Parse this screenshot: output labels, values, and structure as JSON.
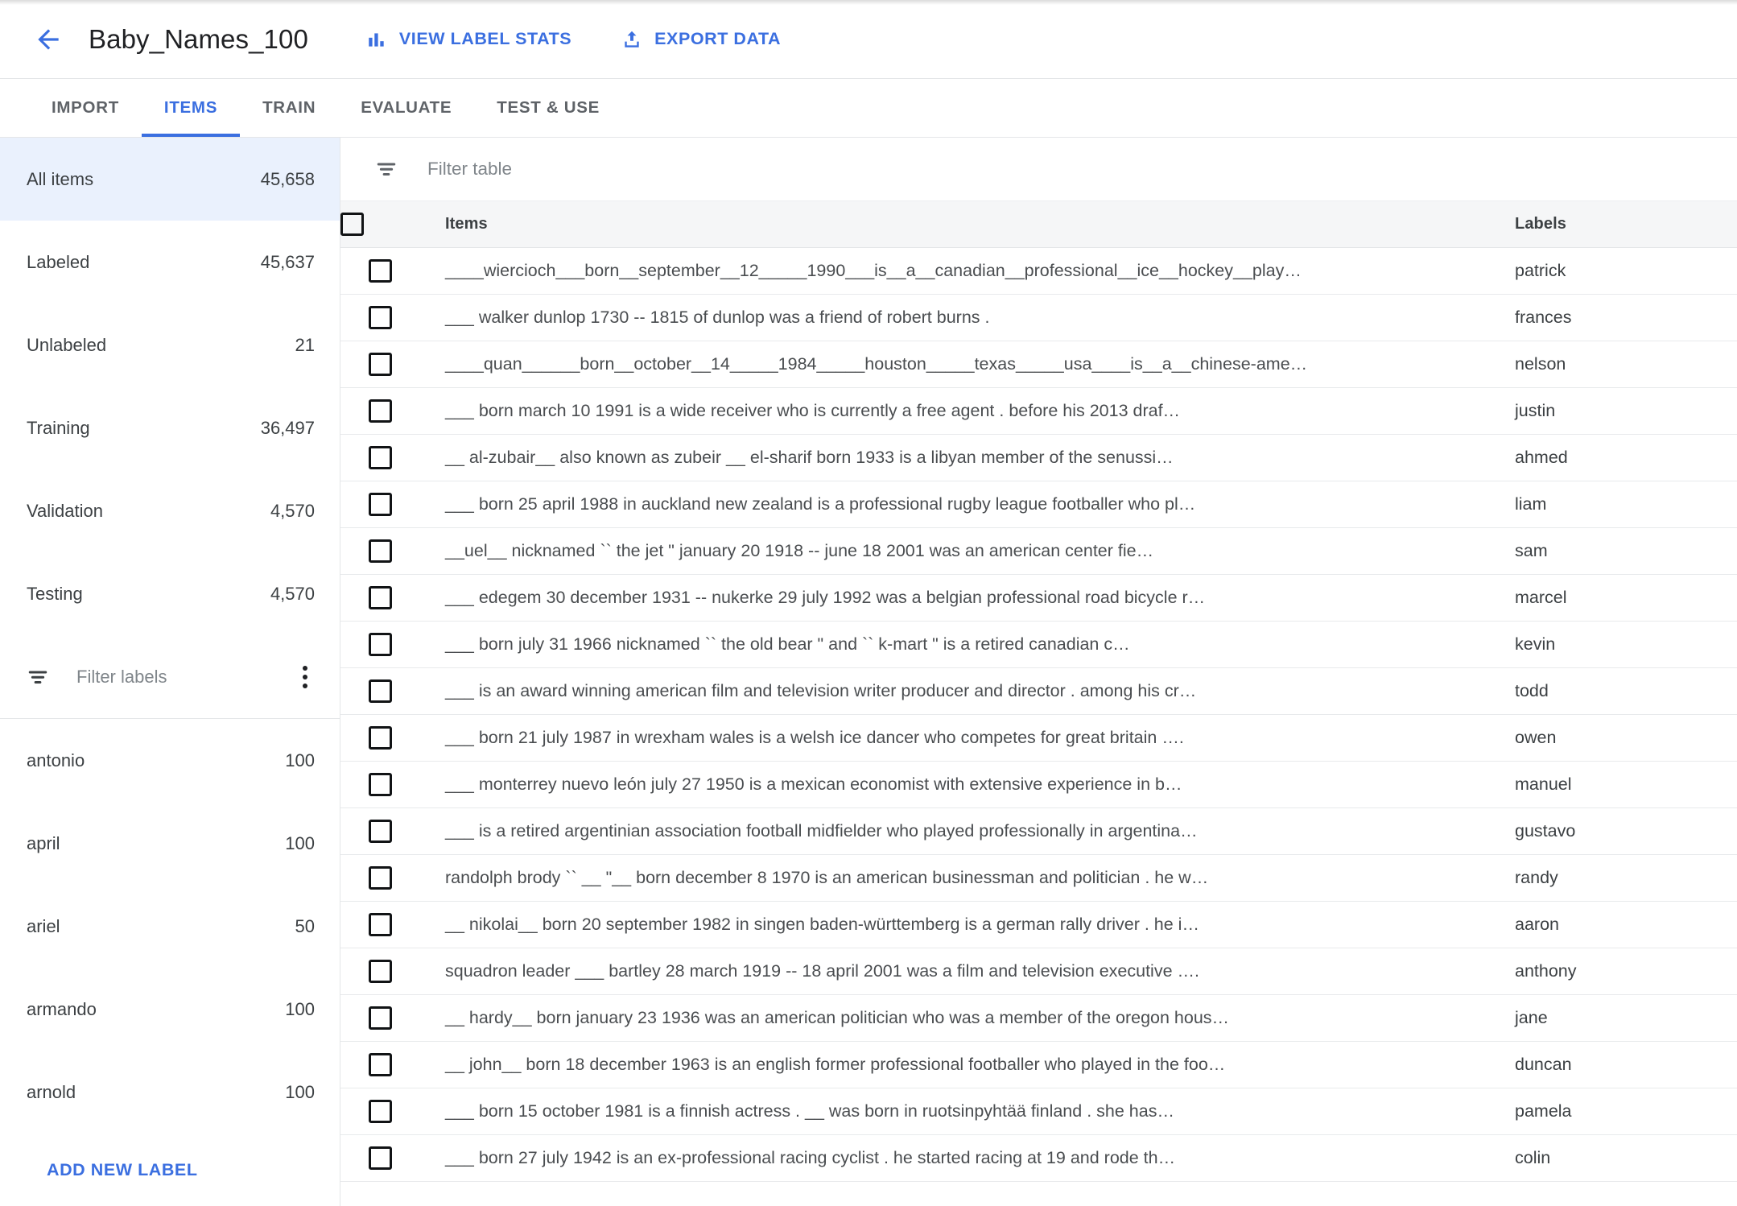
{
  "header": {
    "back_icon": "arrow-back-icon",
    "title": "Baby_Names_100",
    "actions": [
      {
        "icon": "bar-chart-icon",
        "label": "VIEW LABEL STATS"
      },
      {
        "icon": "upload-export-icon",
        "label": "EXPORT DATA"
      }
    ]
  },
  "tabs": [
    {
      "label": "IMPORT",
      "active": false
    },
    {
      "label": "ITEMS",
      "active": true
    },
    {
      "label": "TRAIN",
      "active": false
    },
    {
      "label": "EVALUATE",
      "active": false
    },
    {
      "label": "TEST & USE",
      "active": false
    }
  ],
  "sidebar": {
    "stats": [
      {
        "label": "All items",
        "count": "45,658",
        "selected": true
      },
      {
        "label": "Labeled",
        "count": "45,637",
        "selected": false
      },
      {
        "label": "Unlabeled",
        "count": "21",
        "selected": false
      },
      {
        "label": "Training",
        "count": "36,497",
        "selected": false
      },
      {
        "label": "Validation",
        "count": "4,570",
        "selected": false
      },
      {
        "label": "Testing",
        "count": "4,570",
        "selected": false
      }
    ],
    "filter_labels": {
      "icon": "filter-icon",
      "placeholder": "Filter labels",
      "menu_icon": "more-vert-icon"
    },
    "labels": [
      {
        "name": "antonio",
        "count": "100"
      },
      {
        "name": "april",
        "count": "100"
      },
      {
        "name": "ariel",
        "count": "50"
      },
      {
        "name": "armando",
        "count": "100"
      },
      {
        "name": "arnold",
        "count": "100"
      }
    ],
    "add_new_label": "ADD NEW LABEL"
  },
  "table": {
    "filter": {
      "icon": "filter-icon",
      "placeholder": "Filter table"
    },
    "columns": [
      "",
      "Items",
      "Labels"
    ],
    "header_checkbox": "select-all-checkbox",
    "rows": [
      {
        "item": "____wiercioch___born__september__12_____1990___is__a__canadian__professional__ice__hockey__play…",
        "label": "patrick"
      },
      {
        "item": "___ walker dunlop 1730 -- 1815 of dunlop was a friend of robert burns .",
        "label": "frances"
      },
      {
        "item": "____quan______born__october__14_____1984_____houston_____texas_____usa____is__a__chinese-ame…",
        "label": "nelson"
      },
      {
        "item": "___ born march 10 1991 is a wide receiver who is currently a free agent . before his 2013 draf…",
        "label": "justin"
      },
      {
        "item": "__ al-zubair__ also known as zubeir __ el-sharif born 1933 is a libyan member of the senussi…",
        "label": "ahmed"
      },
      {
        "item": "___ born 25 april 1988 in auckland new zealand is a professional rugby league footballer who pl…",
        "label": "liam"
      },
      {
        "item": "__uel__ nicknamed `` the jet \" january 20 1918 -- june 18 2001 was an american center fie…",
        "label": "sam"
      },
      {
        "item": "___ edegem 30 december 1931 -- nukerke 29 july 1992 was a belgian professional road bicycle r…",
        "label": "marcel"
      },
      {
        "item": "___ born july 31 1966 nicknamed `` the old bear \" and `` k-mart \" is a retired canadian c…",
        "label": "kevin"
      },
      {
        "item": "___ is an award winning american film and television writer producer and director . among his cr…",
        "label": "todd"
      },
      {
        "item": "___ born 21 july 1987 in wrexham wales is a welsh ice dancer who competes for great britain ….",
        "label": "owen"
      },
      {
        "item": "___ monterrey nuevo león july 27 1950 is a mexican economist with extensive experience in b…",
        "label": "manuel"
      },
      {
        "item": "___ is a retired argentinian association football midfielder who played professionally in argentina…",
        "label": "gustavo"
      },
      {
        "item": "randolph brody `` __ \"__ born december 8 1970 is an american businessman and politician . he w…",
        "label": "randy"
      },
      {
        "item": "__ nikolai__ born 20 september 1982 in singen baden-württemberg is a german rally driver . he i…",
        "label": "aaron"
      },
      {
        "item": "squadron leader ___ bartley 28 march 1919 -- 18 april 2001 was a film and television executive ….",
        "label": "anthony"
      },
      {
        "item": "__ hardy__ born january 23 1936 was an american politician who was a member of the oregon hous…",
        "label": "jane"
      },
      {
        "item": "__ john__ born 18 december 1963 is an english former professional footballer who played in the foo…",
        "label": "duncan"
      },
      {
        "item": "___ born 15 october 1981 is a finnish actress . __ was born in ruotsinpyhtää finland . she has…",
        "label": "pamela"
      },
      {
        "item": "___ born 27 july 1942 is an ex-professional racing cyclist . he started racing at 19 and rode th…",
        "label": "colin"
      }
    ]
  },
  "colors": {
    "accent": "#3b6fe0",
    "selected_row_bg": "#eaf1fd",
    "table_header_bg": "#f5f6f7",
    "text_primary": "#3c4043",
    "text_secondary": "#80868b",
    "border": "#e4e6e8"
  }
}
